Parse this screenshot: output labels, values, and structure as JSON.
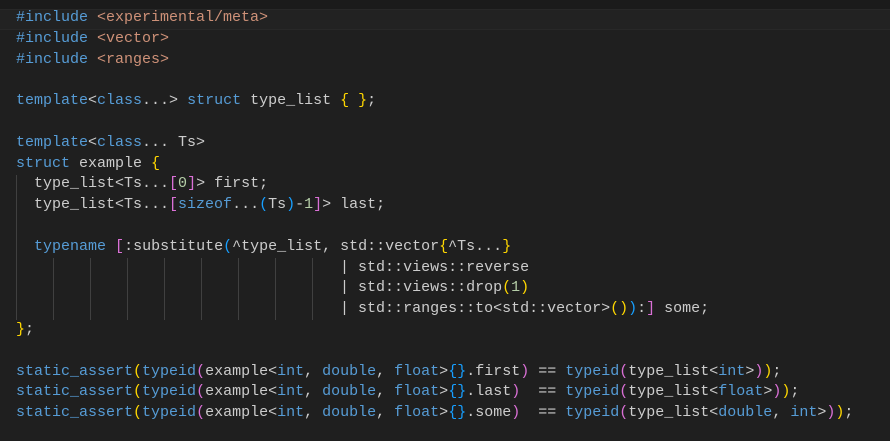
{
  "editor": {
    "theme_colors": {
      "background": "#1f1f1f",
      "keyword": "#569cd6",
      "string": "#ce9178",
      "text": "#cccccc",
      "number": "#b5cea8",
      "bracket_1": "#ffd700",
      "bracket_2": "#da70d6",
      "bracket_3": "#179fff"
    },
    "lines": [
      [
        {
          "t": "#include ",
          "c": "t-pre"
        },
        {
          "t": "<experimental/meta>",
          "c": "t-str"
        }
      ],
      [
        {
          "t": "#include ",
          "c": "t-pre"
        },
        {
          "t": "<vector>",
          "c": "t-str"
        }
      ],
      [
        {
          "t": "#include ",
          "c": "t-pre"
        },
        {
          "t": "<ranges>",
          "c": "t-str"
        }
      ],
      [],
      [
        {
          "t": "template",
          "c": "t-kw"
        },
        {
          "t": "<",
          "c": "t-txt"
        },
        {
          "t": "class",
          "c": "t-kw"
        },
        {
          "t": "...> ",
          "c": "t-txt"
        },
        {
          "t": "struct",
          "c": "t-kw"
        },
        {
          "t": " type_list ",
          "c": "t-txt"
        },
        {
          "t": "{",
          "c": "t-b1"
        },
        {
          "t": " ",
          "c": "t-txt"
        },
        {
          "t": "}",
          "c": "t-b1"
        },
        {
          "t": ";",
          "c": "t-txt"
        }
      ],
      [],
      [
        {
          "t": "template",
          "c": "t-kw"
        },
        {
          "t": "<",
          "c": "t-txt"
        },
        {
          "t": "class",
          "c": "t-kw"
        },
        {
          "t": "... Ts>",
          "c": "t-txt"
        }
      ],
      [
        {
          "t": "struct",
          "c": "t-kw"
        },
        {
          "t": " example ",
          "c": "t-txt"
        },
        {
          "t": "{",
          "c": "t-b1"
        }
      ],
      [
        {
          "t": "  type_list<Ts...",
          "c": "t-txt"
        },
        {
          "t": "[",
          "c": "t-b2"
        },
        {
          "t": "0",
          "c": "t-num"
        },
        {
          "t": "]",
          "c": "t-b2"
        },
        {
          "t": "> first;",
          "c": "t-txt"
        }
      ],
      [
        {
          "t": "  type_list<Ts...",
          "c": "t-txt"
        },
        {
          "t": "[",
          "c": "t-b2"
        },
        {
          "t": "sizeof",
          "c": "t-kw"
        },
        {
          "t": "...",
          "c": "t-txt"
        },
        {
          "t": "(",
          "c": "t-b3"
        },
        {
          "t": "Ts",
          "c": "t-txt"
        },
        {
          "t": ")",
          "c": "t-b3"
        },
        {
          "t": "-",
          "c": "t-txt"
        },
        {
          "t": "1",
          "c": "t-num"
        },
        {
          "t": "]",
          "c": "t-b2"
        },
        {
          "t": "> last;",
          "c": "t-txt"
        }
      ],
      [],
      [
        {
          "t": "  ",
          "c": "t-txt"
        },
        {
          "t": "typename",
          "c": "t-kw"
        },
        {
          "t": " ",
          "c": "t-txt"
        },
        {
          "t": "[",
          "c": "t-b2"
        },
        {
          "t": ":substitute",
          "c": "t-txt"
        },
        {
          "t": "(",
          "c": "t-b3"
        },
        {
          "t": "^type_list, std::vector",
          "c": "t-txt"
        },
        {
          "t": "{",
          "c": "t-b1"
        },
        {
          "t": "^Ts...",
          "c": "t-txt"
        },
        {
          "t": "}",
          "c": "t-b1"
        }
      ],
      [
        {
          "t": "                                    | std::views::reverse",
          "c": "t-txt"
        }
      ],
      [
        {
          "t": "                                    | std::views::drop",
          "c": "t-txt"
        },
        {
          "t": "(",
          "c": "t-b1"
        },
        {
          "t": "1",
          "c": "t-num"
        },
        {
          "t": ")",
          "c": "t-b1"
        }
      ],
      [
        {
          "t": "                                    | std::ranges::to<std::vector>",
          "c": "t-txt"
        },
        {
          "t": "()",
          "c": "t-b1"
        },
        {
          "t": ")",
          "c": "t-b3"
        },
        {
          "t": ":",
          "c": "t-txt"
        },
        {
          "t": "]",
          "c": "t-b2"
        },
        {
          "t": " some;",
          "c": "t-txt"
        }
      ],
      [
        {
          "t": "}",
          "c": "t-b1"
        },
        {
          "t": ";",
          "c": "t-txt"
        }
      ],
      [],
      [
        {
          "t": "static_assert",
          "c": "t-kw"
        },
        {
          "t": "(",
          "c": "t-b1"
        },
        {
          "t": "typeid",
          "c": "t-kw"
        },
        {
          "t": "(",
          "c": "t-b2"
        },
        {
          "t": "example<",
          "c": "t-txt"
        },
        {
          "t": "int",
          "c": "t-kw"
        },
        {
          "t": ", ",
          "c": "t-txt"
        },
        {
          "t": "double",
          "c": "t-kw"
        },
        {
          "t": ", ",
          "c": "t-txt"
        },
        {
          "t": "float",
          "c": "t-kw"
        },
        {
          "t": ">",
          "c": "t-txt"
        },
        {
          "t": "{}",
          "c": "t-b3"
        },
        {
          "t": ".first",
          "c": "t-txt"
        },
        {
          "t": ")",
          "c": "t-b2"
        },
        {
          "t": " == ",
          "c": "t-txt"
        },
        {
          "t": "typeid",
          "c": "t-kw"
        },
        {
          "t": "(",
          "c": "t-b2"
        },
        {
          "t": "type_list<",
          "c": "t-txt"
        },
        {
          "t": "int",
          "c": "t-kw"
        },
        {
          "t": ">",
          "c": "t-txt"
        },
        {
          "t": ")",
          "c": "t-b2"
        },
        {
          "t": ")",
          "c": "t-b1"
        },
        {
          "t": ";",
          "c": "t-txt"
        }
      ],
      [
        {
          "t": "static_assert",
          "c": "t-kw"
        },
        {
          "t": "(",
          "c": "t-b1"
        },
        {
          "t": "typeid",
          "c": "t-kw"
        },
        {
          "t": "(",
          "c": "t-b2"
        },
        {
          "t": "example<",
          "c": "t-txt"
        },
        {
          "t": "int",
          "c": "t-kw"
        },
        {
          "t": ", ",
          "c": "t-txt"
        },
        {
          "t": "double",
          "c": "t-kw"
        },
        {
          "t": ", ",
          "c": "t-txt"
        },
        {
          "t": "float",
          "c": "t-kw"
        },
        {
          "t": ">",
          "c": "t-txt"
        },
        {
          "t": "{}",
          "c": "t-b3"
        },
        {
          "t": ".last",
          "c": "t-txt"
        },
        {
          "t": ")",
          "c": "t-b2"
        },
        {
          "t": "  == ",
          "c": "t-txt"
        },
        {
          "t": "typeid",
          "c": "t-kw"
        },
        {
          "t": "(",
          "c": "t-b2"
        },
        {
          "t": "type_list<",
          "c": "t-txt"
        },
        {
          "t": "float",
          "c": "t-kw"
        },
        {
          "t": ">",
          "c": "t-txt"
        },
        {
          "t": ")",
          "c": "t-b2"
        },
        {
          "t": ")",
          "c": "t-b1"
        },
        {
          "t": ";",
          "c": "t-txt"
        }
      ],
      [
        {
          "t": "static_assert",
          "c": "t-kw"
        },
        {
          "t": "(",
          "c": "t-b1"
        },
        {
          "t": "typeid",
          "c": "t-kw"
        },
        {
          "t": "(",
          "c": "t-b2"
        },
        {
          "t": "example<",
          "c": "t-txt"
        },
        {
          "t": "int",
          "c": "t-kw"
        },
        {
          "t": ", ",
          "c": "t-txt"
        },
        {
          "t": "double",
          "c": "t-kw"
        },
        {
          "t": ", ",
          "c": "t-txt"
        },
        {
          "t": "float",
          "c": "t-kw"
        },
        {
          "t": ">",
          "c": "t-txt"
        },
        {
          "t": "{}",
          "c": "t-b3"
        },
        {
          "t": ".some",
          "c": "t-txt"
        },
        {
          "t": ")",
          "c": "t-b2"
        },
        {
          "t": "  == ",
          "c": "t-txt"
        },
        {
          "t": "typeid",
          "c": "t-kw"
        },
        {
          "t": "(",
          "c": "t-b2"
        },
        {
          "t": "type_list<",
          "c": "t-txt"
        },
        {
          "t": "double",
          "c": "t-kw"
        },
        {
          "t": ", ",
          "c": "t-txt"
        },
        {
          "t": "int",
          "c": "t-kw"
        },
        {
          "t": ">",
          "c": "t-txt"
        },
        {
          "t": ")",
          "c": "t-b2"
        },
        {
          "t": ")",
          "c": "t-b1"
        },
        {
          "t": ";",
          "c": "t-txt"
        }
      ]
    ]
  }
}
